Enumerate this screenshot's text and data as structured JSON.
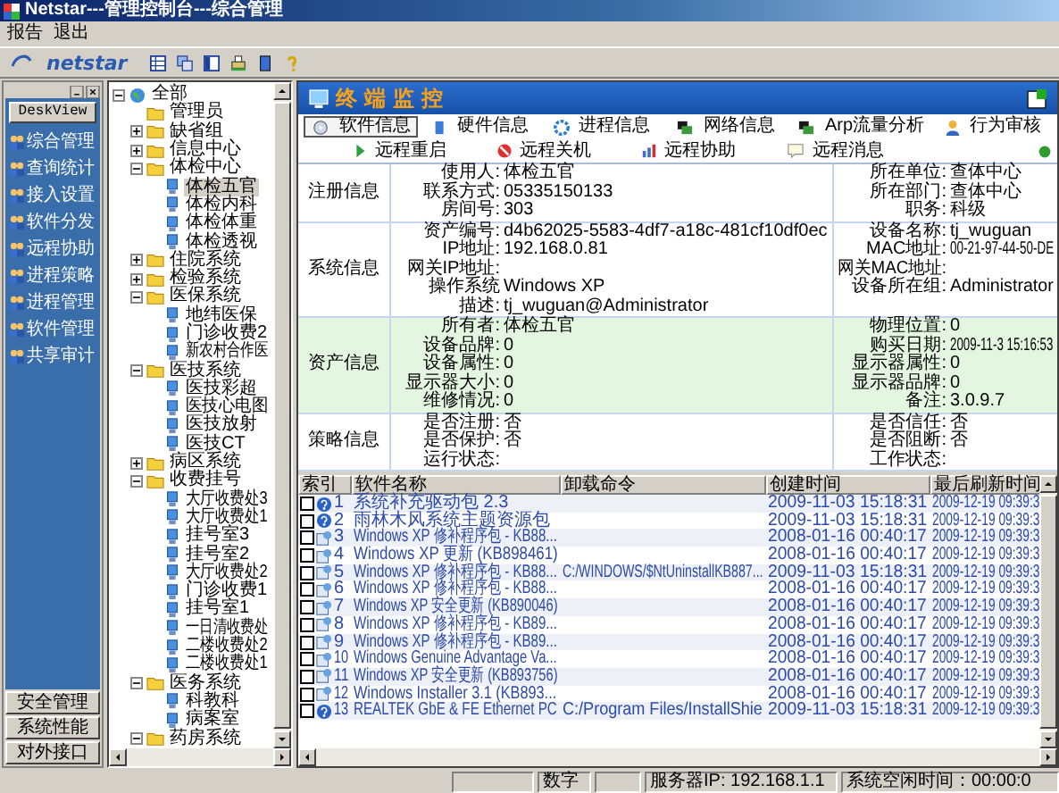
{
  "window": {
    "title": "Netstar---管理控制台---综合管理"
  },
  "menu": [
    "报告",
    "退出"
  ],
  "toolbar": {
    "logo": "netstar"
  },
  "nav": {
    "header": "DeskView",
    "items": [
      {
        "label": "综合管理"
      },
      {
        "label": "查询统计"
      },
      {
        "label": "接入设置"
      },
      {
        "label": "软件分发"
      },
      {
        "label": "远程协助"
      },
      {
        "label": "进程策略"
      },
      {
        "label": "进程管理"
      },
      {
        "label": "软件管理"
      },
      {
        "label": "共享审计"
      }
    ],
    "bottom": [
      "安全管理",
      "系统性能",
      "对外接口"
    ]
  },
  "tree": {
    "label": "全部",
    "kind": "root",
    "expanded": true,
    "selected": false,
    "children": [
      {
        "label": "管理员",
        "kind": "folder",
        "selected": false
      },
      {
        "label": "缺省组",
        "kind": "folder",
        "expanded": false,
        "selected": false
      },
      {
        "label": "信息中心",
        "kind": "folder",
        "expanded": false,
        "selected": false
      },
      {
        "label": "体检中心",
        "kind": "folder",
        "expanded": true,
        "selected": false,
        "children": [
          {
            "label": "体检五官",
            "kind": "computer",
            "selected": true
          },
          {
            "label": "体检内科",
            "kind": "computer",
            "selected": false
          },
          {
            "label": "体检体重",
            "kind": "computer",
            "selected": false
          },
          {
            "label": "体检透视",
            "kind": "computer",
            "selected": false
          }
        ]
      },
      {
        "label": "住院系统",
        "kind": "folder",
        "expanded": false,
        "selected": false
      },
      {
        "label": "检验系统",
        "kind": "folder",
        "expanded": false,
        "selected": false
      },
      {
        "label": "医保系统",
        "kind": "folder",
        "expanded": true,
        "selected": false,
        "children": [
          {
            "label": "地纬医保",
            "kind": "computer",
            "selected": false
          },
          {
            "label": "门诊收费2",
            "kind": "computer",
            "selected": false
          },
          {
            "label": "新农村合作医",
            "kind": "computer",
            "selected": false
          }
        ]
      },
      {
        "label": "医技系统",
        "kind": "folder",
        "expanded": true,
        "selected": false,
        "children": [
          {
            "label": "医技彩超",
            "kind": "computer",
            "selected": false
          },
          {
            "label": "医技心电图",
            "kind": "computer",
            "selected": false
          },
          {
            "label": "医技放射",
            "kind": "computer",
            "selected": false
          },
          {
            "label": "医技CT",
            "kind": "computer",
            "selected": false
          }
        ]
      },
      {
        "label": "病区系统",
        "kind": "folder",
        "expanded": false,
        "selected": false
      },
      {
        "label": "收费挂号",
        "kind": "folder",
        "expanded": true,
        "selected": false,
        "children": [
          {
            "label": "大厅收费处3",
            "kind": "computer",
            "selected": false
          },
          {
            "label": "大厅收费处1",
            "kind": "computer",
            "selected": false
          },
          {
            "label": "挂号室3",
            "kind": "computer",
            "selected": false
          },
          {
            "label": "挂号室2",
            "kind": "computer",
            "selected": false
          },
          {
            "label": "大厅收费处2",
            "kind": "computer",
            "selected": false
          },
          {
            "label": "门诊收费1",
            "kind": "computer",
            "selected": false
          },
          {
            "label": "挂号室1",
            "kind": "computer",
            "selected": false
          },
          {
            "label": "一日清收费处",
            "kind": "computer",
            "selected": false
          },
          {
            "label": "二楼收费处2",
            "kind": "computer",
            "selected": false
          },
          {
            "label": "二楼收费处1",
            "kind": "computer",
            "selected": false
          }
        ]
      },
      {
        "label": "医务系统",
        "kind": "folder",
        "expanded": true,
        "selected": false,
        "children": [
          {
            "label": "科教科",
            "kind": "computer",
            "selected": false
          },
          {
            "label": "病案室",
            "kind": "computer",
            "selected": false
          }
        ]
      },
      {
        "label": "药房系统",
        "kind": "folder",
        "expanded": true,
        "selected": false
      }
    ]
  },
  "panel": {
    "title": "终端监控",
    "tabs": [
      {
        "label": "软件信息",
        "selected": true
      },
      {
        "label": "硬件信息",
        "selected": false
      },
      {
        "label": "进程信息",
        "selected": false
      },
      {
        "label": "网络信息",
        "selected": false
      },
      {
        "label": "Arp流量分析",
        "selected": false
      },
      {
        "label": "行为审核",
        "selected": false
      }
    ],
    "actions": [
      "远程重启",
      "远程关机",
      "远程协助",
      "远程消息"
    ]
  },
  "info": [
    {
      "section": "注册信息",
      "shade": false,
      "rows": [
        {
          "label": "使用人:",
          "value": "体检五官",
          "label2": "所在单位:",
          "value2": "查体中心"
        },
        {
          "label": "联系方式:",
          "value": "05335150133",
          "label2": "所在部门:",
          "value2": "查体中心"
        },
        {
          "label": "房间号:",
          "value": "303",
          "label2": "职务:",
          "value2": "科级"
        }
      ]
    },
    {
      "section": "系统信息",
      "shade": false,
      "rows": [
        {
          "label": "资产编号:",
          "value": "d4b62025-5583-4df7-a18c-481cf10df0ec",
          "label2": "设备名称:",
          "value2": "tj_wuguan"
        },
        {
          "label": "IP地址:",
          "value": "192.168.0.81",
          "label2": "MAC地址:",
          "value2": "00-21-97-44-50-DE"
        },
        {
          "label": "网关IP地址:",
          "label2": "网关MAC地址:"
        },
        {
          "label": "操作系统",
          "value": "Windows XP",
          "label2": "设备所在组:",
          "value2": "Administrator"
        },
        {
          "label": "描述:",
          "value": "tj_wuguan@Administrator"
        }
      ]
    },
    {
      "section": "资产信息",
      "shade": true,
      "rows": [
        {
          "label": "所有者:",
          "value": "体检五官",
          "label2": "物理位置:",
          "value2": "0"
        },
        {
          "label": "设备品牌:",
          "value": "0",
          "label2": "购买日期:",
          "value2": "2009-11-3 15:16:53"
        },
        {
          "label": "设备属性:",
          "value": "0",
          "label2": "显示器属性:",
          "value2": "0"
        },
        {
          "label": "显示器大小:",
          "value": "0",
          "label2": "显示器品牌:",
          "value2": "0"
        },
        {
          "label": "维修情况:",
          "value": "0",
          "label2": "备注:",
          "value2": "3.0.9.7"
        }
      ]
    },
    {
      "section": "策略信息",
      "shade": false,
      "rows": [
        {
          "label": "是否注册:",
          "value": "否",
          "label2": "是否信任:",
          "value2": "否"
        },
        {
          "label": "是否保护:",
          "value": "否",
          "label2": "是否阻断:",
          "value2": "否"
        },
        {
          "label": "运行状态:",
          "label2": "工作状态:"
        }
      ]
    }
  ],
  "software": {
    "columns": [
      "索引",
      "软件名称",
      "卸载命令",
      "创建时间",
      "最后刷新时间"
    ],
    "rows": [
      {
        "index": "1",
        "kind": "help",
        "checked": false,
        "name": "系统补充驱动包 2.3",
        "created": "2009-11-03 15:18:31",
        "refreshed": "2009-12-19 09:39:3"
      },
      {
        "index": "2",
        "kind": "help",
        "checked": false,
        "name": "雨林木风系统主题资源包",
        "created": "2009-11-03 15:18:31",
        "refreshed": "2009-12-19 09:39:3"
      },
      {
        "index": "3",
        "kind": "setup",
        "checked": false,
        "name": "Windows XP 修补程序包 - KB88...",
        "created": "2008-01-16 00:40:17",
        "refreshed": "2009-12-19 09:39:3"
      },
      {
        "index": "4",
        "kind": "setup",
        "checked": false,
        "name": "Windows XP 更新 (KB898461)",
        "created": "2008-01-16 00:40:17",
        "refreshed": "2009-12-19 09:39:3"
      },
      {
        "index": "5",
        "kind": "setup",
        "checked": false,
        "name": "Windows XP 修补程序包 - KB88...",
        "command": "C:/WINDOWS/$NtUninstallKB887...",
        "created": "2009-11-03 15:18:31",
        "refreshed": "2009-12-19 09:39:3"
      },
      {
        "index": "6",
        "kind": "setup",
        "checked": false,
        "name": "Windows XP 修补程序包 - KB88...",
        "created": "2008-01-16 00:40:17",
        "refreshed": "2009-12-19 09:39:3"
      },
      {
        "index": "7",
        "kind": "setup",
        "checked": false,
        "name": "Windows XP 安全更新 (KB890046)",
        "created": "2008-01-16 00:40:17",
        "refreshed": "2009-12-19 09:39:3"
      },
      {
        "index": "8",
        "kind": "setup",
        "checked": false,
        "name": "Windows XP 修补程序包 - KB89...",
        "created": "2008-01-16 00:40:17",
        "refreshed": "2009-12-19 09:39:3"
      },
      {
        "index": "9",
        "kind": "setup",
        "checked": false,
        "name": "Windows XP 修补程序包 - KB89...",
        "created": "2008-01-16 00:40:17",
        "refreshed": "2009-12-19 09:39:3"
      },
      {
        "index": "10",
        "kind": "setup",
        "checked": false,
        "name": "Windows Genuine Advantage Va...",
        "created": "2008-01-16 00:40:17",
        "refreshed": "2009-12-19 09:39:3"
      },
      {
        "index": "11",
        "kind": "setup",
        "checked": false,
        "name": "Windows XP 安全更新 (KB893756)",
        "created": "2008-01-16 00:40:17",
        "refreshed": "2009-12-19 09:39:3"
      },
      {
        "index": "12",
        "kind": "setup",
        "checked": false,
        "name": "Windows Installer 3.1 (KB893...",
        "created": "2008-01-16 00:40:17",
        "refreshed": "2009-12-19 09:39:3"
      },
      {
        "index": "13",
        "kind": "help",
        "checked": false,
        "name": "REALTEK GbE & FE Ethernet PC",
        "command": "C:/Program Files/InstallShie",
        "created": "2009-11-03 15:18:31",
        "refreshed": "2009-12-19 09:39:3"
      }
    ]
  },
  "status_bar": [
    "数字",
    "服务器IP: 192.168.1.1",
    "系统空闲时间：00:00:0"
  ]
}
